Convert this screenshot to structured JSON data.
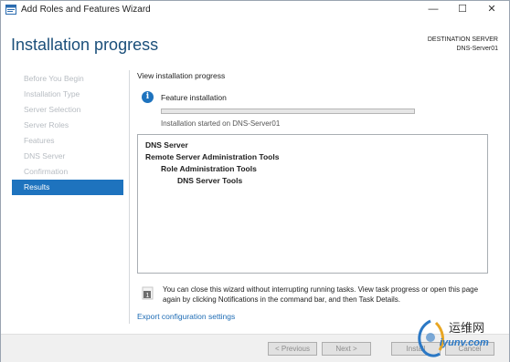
{
  "window": {
    "title": "Add Roles and Features Wizard",
    "controls": {
      "minimize": "—",
      "maximize": "☐",
      "close": "✕"
    }
  },
  "header": {
    "title": "Installation progress",
    "destination_label": "DESTINATION SERVER",
    "destination_server": "DNS-Server01"
  },
  "sidebar": {
    "items": [
      {
        "label": "Before You Begin",
        "active": false
      },
      {
        "label": "Installation Type",
        "active": false
      },
      {
        "label": "Server Selection",
        "active": false
      },
      {
        "label": "Server Roles",
        "active": false
      },
      {
        "label": "Features",
        "active": false
      },
      {
        "label": "DNS Server",
        "active": false
      },
      {
        "label": "Confirmation",
        "active": false
      },
      {
        "label": "Results",
        "active": true
      }
    ]
  },
  "main": {
    "subheading": "View installation progress",
    "feature_label": "Feature installation",
    "progress_fraction": 0,
    "status": "Installation started on DNS-Server01",
    "results": [
      {
        "label": "DNS Server",
        "level": 0
      },
      {
        "label": "Remote Server Administration Tools",
        "level": 1
      },
      {
        "label": "Role Administration Tools",
        "level": 2
      },
      {
        "label": "DNS Server Tools",
        "level": 3
      }
    ],
    "note": "You can close this wizard without interrupting running tasks. View task progress or open this page again by clicking Notifications in the command bar, and then Task Details.",
    "export_link": "Export configuration settings"
  },
  "footer": {
    "previous_label": "< Previous",
    "next_label": "Next >",
    "install_label": "Install",
    "cancel_label": "Cancel"
  },
  "watermark": {
    "line1": "运维网",
    "line2": "iyunv.com"
  },
  "colors": {
    "accent": "#1e73be",
    "heading": "#1b4f7a",
    "link": "#1e6cb5",
    "progress": "#06b025"
  }
}
